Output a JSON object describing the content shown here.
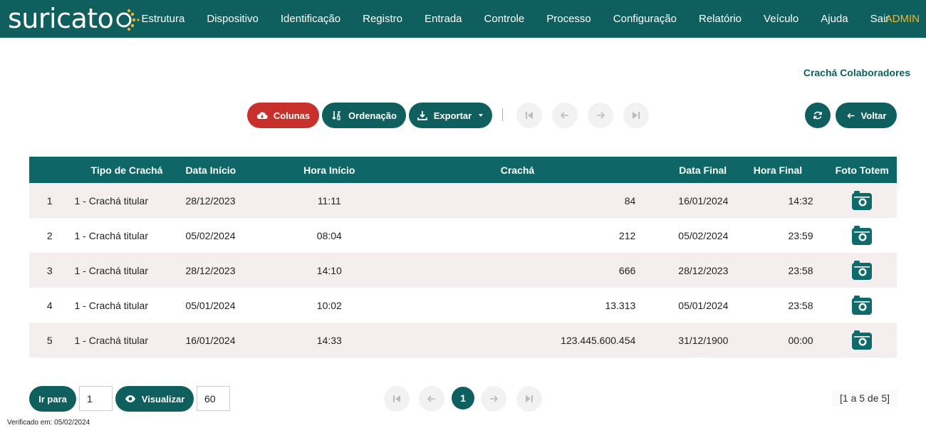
{
  "app": {
    "logo_text": "suricato",
    "user": "ADMIN",
    "brand_color": "#0f5f5f",
    "accent_color": "#f0b429",
    "danger_color": "#c7302b"
  },
  "nav": {
    "items": [
      "Estrutura",
      "Dispositivo",
      "Identificação",
      "Registro",
      "Entrada",
      "Controle",
      "Processo",
      "Configuração",
      "Relatório",
      "Veículo",
      "Ajuda",
      "Sair"
    ]
  },
  "page": {
    "title": "Crachá Colaboradores"
  },
  "toolbar": {
    "columns_label": "Colunas",
    "sort_label": "Ordenação",
    "export_label": "Exportar",
    "back_label": "Voltar"
  },
  "table": {
    "headers": [
      "",
      "Tipo de Crachá",
      "Data Início",
      "Hora Início",
      "Crachá",
      "Data Final",
      "Hora Final",
      "Foto Totem"
    ],
    "rows": [
      {
        "n": "1",
        "tipo": "1 - Crachá titular",
        "data_inicio": "28/12/2023",
        "hora_inicio": "11:11",
        "cracha": "84",
        "data_final": "16/01/2024",
        "hora_final": "14:32",
        "foto_icon": "camera-icon"
      },
      {
        "n": "2",
        "tipo": "1 - Crachá titular",
        "data_inicio": "05/02/2024",
        "hora_inicio": "08:04",
        "cracha": "212",
        "data_final": "05/02/2024",
        "hora_final": "23:59",
        "foto_icon": "camera-icon"
      },
      {
        "n": "3",
        "tipo": "1 - Crachá titular",
        "data_inicio": "28/12/2023",
        "hora_inicio": "14:10",
        "cracha": "666",
        "data_final": "28/12/2023",
        "hora_final": "23:58",
        "foto_icon": "camera-icon"
      },
      {
        "n": "4",
        "tipo": "1 - Crachá titular",
        "data_inicio": "05/01/2024",
        "hora_inicio": "10:02",
        "cracha": "13.313",
        "data_final": "05/01/2024",
        "hora_final": "23:58",
        "foto_icon": "camera-icon"
      },
      {
        "n": "5",
        "tipo": "1 - Crachá titular",
        "data_inicio": "16/01/2024",
        "hora_inicio": "14:33",
        "cracha": "123.445.600.454",
        "data_final": "31/12/1900",
        "hora_final": "00:00",
        "foto_icon": "camera-icon"
      }
    ]
  },
  "footer": {
    "goto_label": "Ir para",
    "goto_value": "1",
    "view_label": "Visualizar",
    "view_value": "60",
    "current_page": "1",
    "range_text": "[1 a 5 de 5]",
    "verified_text": "Verificado em: 05/02/2024"
  }
}
